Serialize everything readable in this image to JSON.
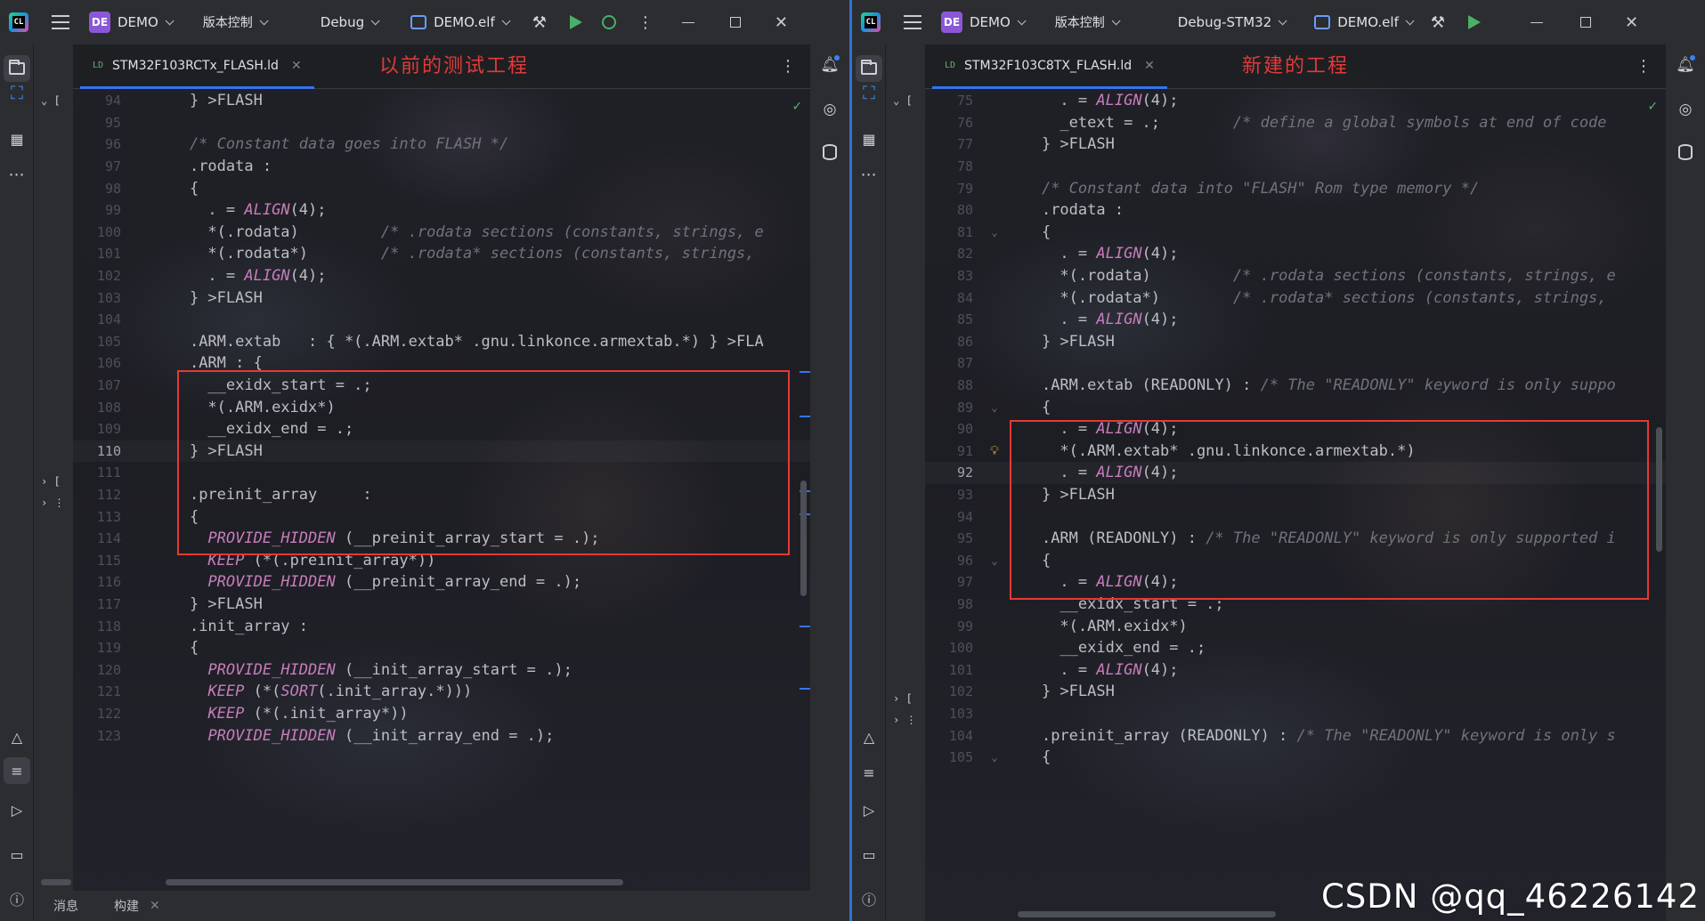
{
  "left": {
    "project_badge": "DE",
    "project_name": "DEMO",
    "vcs_label": "版本控制",
    "run_config": "Debug",
    "run_target": "DEMO.elf",
    "tab_label": "STM32F103RCTx_FLASH.ld",
    "tab_icon": "LD",
    "annotation": "以前的测试工程",
    "tree_marks": [
      "⌄ [",
      "› [",
      "› ⋮"
    ],
    "bottom_tabs": [
      "消息",
      "构建"
    ],
    "lines": [
      {
        "n": "94",
        "t": [
          [
            "} >FLASH",
            ""
          ]
        ]
      },
      {
        "n": "95",
        "t": []
      },
      {
        "n": "96",
        "t": [
          [
            "/* Constant data goes into FLASH */",
            "cm"
          ]
        ]
      },
      {
        "n": "97",
        "t": [
          [
            ".rodata :",
            ""
          ]
        ]
      },
      {
        "n": "98",
        "t": [
          [
            "{",
            ""
          ]
        ]
      },
      {
        "n": "99",
        "t": [
          [
            "  . = ",
            ""
          ],
          [
            "ALIGN",
            "fn"
          ],
          [
            "(4);",
            ""
          ]
        ]
      },
      {
        "n": "100",
        "t": [
          [
            "  *(.rodata)         ",
            ""
          ],
          [
            "/* .rodata sections (constants, strings, e",
            "cm"
          ]
        ]
      },
      {
        "n": "101",
        "t": [
          [
            "  *(.rodata*)        ",
            ""
          ],
          [
            "/* .rodata* sections (constants, strings,",
            "cm"
          ]
        ]
      },
      {
        "n": "102",
        "t": [
          [
            "  . = ",
            ""
          ],
          [
            "ALIGN",
            "fn"
          ],
          [
            "(4);",
            ""
          ]
        ]
      },
      {
        "n": "103",
        "t": [
          [
            "} >FLASH",
            ""
          ]
        ]
      },
      {
        "n": "104",
        "t": []
      },
      {
        "n": "105",
        "t": [
          [
            ".ARM.extab   : { *(.ARM.extab* .gnu.linkonce.armextab.*) } >FLA",
            ""
          ]
        ]
      },
      {
        "n": "106",
        "t": [
          [
            ".ARM : {",
            ""
          ]
        ]
      },
      {
        "n": "107",
        "t": [
          [
            "  __exidx_start = .;",
            ""
          ]
        ]
      },
      {
        "n": "108",
        "t": [
          [
            "  *(.ARM.exidx*)",
            ""
          ]
        ]
      },
      {
        "n": "109",
        "t": [
          [
            "  __exidx_end = .;",
            ""
          ]
        ]
      },
      {
        "n": "110",
        "t": [
          [
            "} >FLASH",
            ""
          ]
        ],
        "current": true
      },
      {
        "n": "111",
        "t": []
      },
      {
        "n": "112",
        "t": [
          [
            ".preinit_array     :",
            ""
          ]
        ]
      },
      {
        "n": "113",
        "t": [
          [
            "{",
            ""
          ]
        ]
      },
      {
        "n": "114",
        "t": [
          [
            "  ",
            ""
          ],
          [
            "PROVIDE_HIDDEN",
            "fn"
          ],
          [
            " (__preinit_array_start = .);",
            ""
          ]
        ]
      },
      {
        "n": "115",
        "t": [
          [
            "  ",
            ""
          ],
          [
            "KEEP",
            "fn"
          ],
          [
            " (*(.preinit_array*))",
            ""
          ]
        ]
      },
      {
        "n": "116",
        "t": [
          [
            "  ",
            ""
          ],
          [
            "PROVIDE_HIDDEN",
            "fn"
          ],
          [
            " (__preinit_array_end = .);",
            ""
          ]
        ]
      },
      {
        "n": "117",
        "t": [
          [
            "} >FLASH",
            ""
          ]
        ]
      },
      {
        "n": "118",
        "t": [
          [
            ".init_array :",
            ""
          ]
        ]
      },
      {
        "n": "119",
        "t": [
          [
            "{",
            ""
          ]
        ]
      },
      {
        "n": "120",
        "t": [
          [
            "  ",
            ""
          ],
          [
            "PROVIDE_HIDDEN",
            "fn"
          ],
          [
            " (__init_array_start = .);",
            ""
          ]
        ]
      },
      {
        "n": "121",
        "t": [
          [
            "  ",
            ""
          ],
          [
            "KEEP",
            "fn"
          ],
          [
            " (*(",
            ""
          ],
          [
            "SORT",
            "fn"
          ],
          [
            "(.init_array.*)))",
            ""
          ]
        ]
      },
      {
        "n": "122",
        "t": [
          [
            "  ",
            ""
          ],
          [
            "KEEP",
            "fn"
          ],
          [
            " (*(.init_array*))",
            ""
          ]
        ]
      },
      {
        "n": "123",
        "t": [
          [
            "  ",
            ""
          ],
          [
            "PROVIDE_HIDDEN",
            "fn"
          ],
          [
            " (__init_array_end = .);",
            ""
          ]
        ]
      }
    ]
  },
  "right": {
    "project_badge": "DE",
    "project_name": "DEMO",
    "vcs_label": "版本控制",
    "run_config": "Debug-STM32",
    "run_target": "DEMO.elf",
    "tab_label": "STM32F103C8TX_FLASH.ld",
    "tab_icon": "LD",
    "annotation": "新建的工程",
    "tree_marks": [
      "⌄ [",
      "› [",
      "› ⋮"
    ],
    "lines": [
      {
        "n": "75",
        "t": [
          [
            "  . = ",
            ""
          ],
          [
            "ALIGN",
            "fn"
          ],
          [
            "(4);",
            ""
          ]
        ]
      },
      {
        "n": "76",
        "t": [
          [
            "  _etext = .;        ",
            ""
          ],
          [
            "/* define a global symbols at end of code",
            "cm"
          ]
        ]
      },
      {
        "n": "77",
        "t": [
          [
            "} >FLASH",
            ""
          ]
        ]
      },
      {
        "n": "78",
        "t": []
      },
      {
        "n": "79",
        "t": [
          [
            "/* Constant data into \"FLASH\" Rom type memory */",
            "cm"
          ]
        ]
      },
      {
        "n": "80",
        "t": [
          [
            ".rodata :",
            ""
          ]
        ]
      },
      {
        "n": "81",
        "t": [
          [
            "{",
            ""
          ]
        ],
        "fold": "⌄"
      },
      {
        "n": "82",
        "t": [
          [
            "  . = ",
            ""
          ],
          [
            "ALIGN",
            "fn"
          ],
          [
            "(4);",
            ""
          ]
        ]
      },
      {
        "n": "83",
        "t": [
          [
            "  *(.rodata)         ",
            ""
          ],
          [
            "/* .rodata sections (constants, strings, e",
            "cm"
          ]
        ]
      },
      {
        "n": "84",
        "t": [
          [
            "  *(.rodata*)        ",
            ""
          ],
          [
            "/* .rodata* sections (constants, strings,",
            "cm"
          ]
        ]
      },
      {
        "n": "85",
        "t": [
          [
            "  . = ",
            ""
          ],
          [
            "ALIGN",
            "fn"
          ],
          [
            "(4);",
            ""
          ]
        ]
      },
      {
        "n": "86",
        "t": [
          [
            "} >FLASH",
            ""
          ]
        ]
      },
      {
        "n": "87",
        "t": []
      },
      {
        "n": "88",
        "t": [
          [
            ".ARM.extab (READONLY) : ",
            ""
          ],
          [
            "/* The \"READONLY\" keyword is only suppo",
            "cm"
          ]
        ]
      },
      {
        "n": "89",
        "t": [
          [
            "{",
            ""
          ]
        ],
        "fold": "⌄"
      },
      {
        "n": "90",
        "t": [
          [
            "  . = ",
            ""
          ],
          [
            "ALIGN",
            "fn"
          ],
          [
            "(4);",
            ""
          ]
        ]
      },
      {
        "n": "91",
        "t": [
          [
            "  *(.ARM.extab* .gnu.linkonce.armextab.*)",
            ""
          ]
        ],
        "bulb": true
      },
      {
        "n": "92",
        "t": [
          [
            "  . = ",
            ""
          ],
          [
            "ALIGN",
            "fn"
          ],
          [
            "(4);",
            ""
          ]
        ],
        "current": true
      },
      {
        "n": "93",
        "t": [
          [
            "} >FLASH",
            ""
          ]
        ]
      },
      {
        "n": "94",
        "t": []
      },
      {
        "n": "95",
        "t": [
          [
            ".ARM (READONLY) : ",
            ""
          ],
          [
            "/* The \"READONLY\" keyword is only supported i",
            "cm"
          ]
        ]
      },
      {
        "n": "96",
        "t": [
          [
            "{",
            ""
          ]
        ],
        "fold": "⌄"
      },
      {
        "n": "97",
        "t": [
          [
            "  . = ",
            ""
          ],
          [
            "ALIGN",
            "fn"
          ],
          [
            "(4);",
            ""
          ]
        ]
      },
      {
        "n": "98",
        "t": [
          [
            "  __exidx_start = .;",
            ""
          ]
        ]
      },
      {
        "n": "99",
        "t": [
          [
            "  *(.ARM.exidx*)",
            ""
          ]
        ]
      },
      {
        "n": "100",
        "t": [
          [
            "  __exidx_end = .;",
            ""
          ]
        ]
      },
      {
        "n": "101",
        "t": [
          [
            "  . = ",
            ""
          ],
          [
            "ALIGN",
            "fn"
          ],
          [
            "(4);",
            ""
          ]
        ]
      },
      {
        "n": "102",
        "t": [
          [
            "} >FLASH",
            ""
          ]
        ]
      },
      {
        "n": "103",
        "t": []
      },
      {
        "n": "104",
        "t": [
          [
            ".preinit_array (READONLY) : ",
            ""
          ],
          [
            "/* The \"READONLY\" keyword is only s",
            "cm"
          ]
        ]
      },
      {
        "n": "105",
        "t": [
          [
            "{",
            ""
          ]
        ],
        "fold": "⌄"
      }
    ]
  },
  "watermark": "CSDN @qq_46226142",
  "colors": {
    "accent": "#3574f0",
    "annotation_red": "#e53935",
    "keyword_magenta": "#c77dbb",
    "run_green": "#4caf68"
  }
}
